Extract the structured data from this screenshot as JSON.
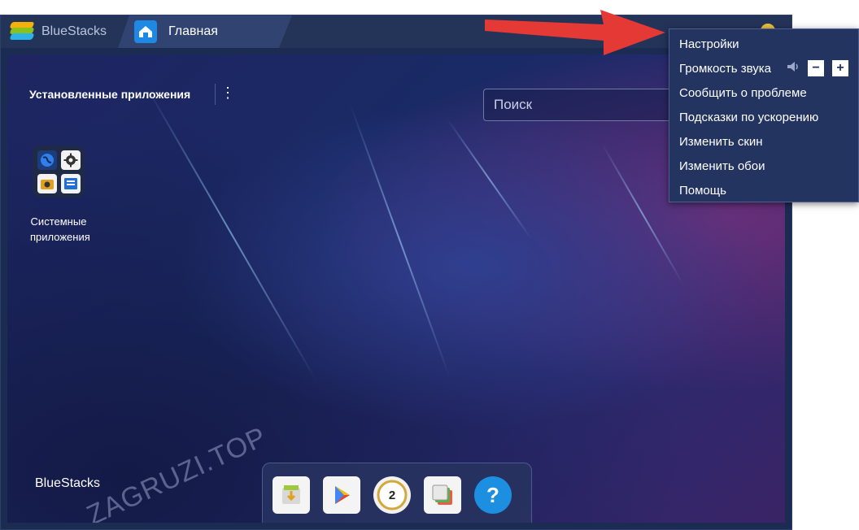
{
  "titlebar": {
    "app_name": "BlueStacks",
    "tab_label": "Главная"
  },
  "desktop": {
    "section_title": "Установленные приложения",
    "kebab_glyph": "⋮",
    "search": {
      "placeholder": "Поиск",
      "value": ""
    },
    "apps": [
      {
        "label": "Системные приложения"
      }
    ],
    "brand_watermark": "BlueStacks"
  },
  "dock": {
    "items": [
      "apk-install",
      "play-store",
      "level",
      "multi-instance",
      "help"
    ],
    "help_glyph": "?",
    "level_number": "2"
  },
  "context_menu": {
    "items": [
      "Настройки",
      "Громкость звука",
      "Сообщить о проблеме",
      "Подсказки по ускорению",
      "Изменить скин",
      "Изменить обои",
      "Помощь"
    ],
    "vol_minus": "−",
    "vol_plus": "+"
  },
  "overlay_watermark": "ZAGRUZI.TOP",
  "colors": {
    "window_bg": "#1b2b52",
    "menu_bg": "#243460",
    "accent": "#1d8fe0",
    "arrow": "#e53935"
  }
}
